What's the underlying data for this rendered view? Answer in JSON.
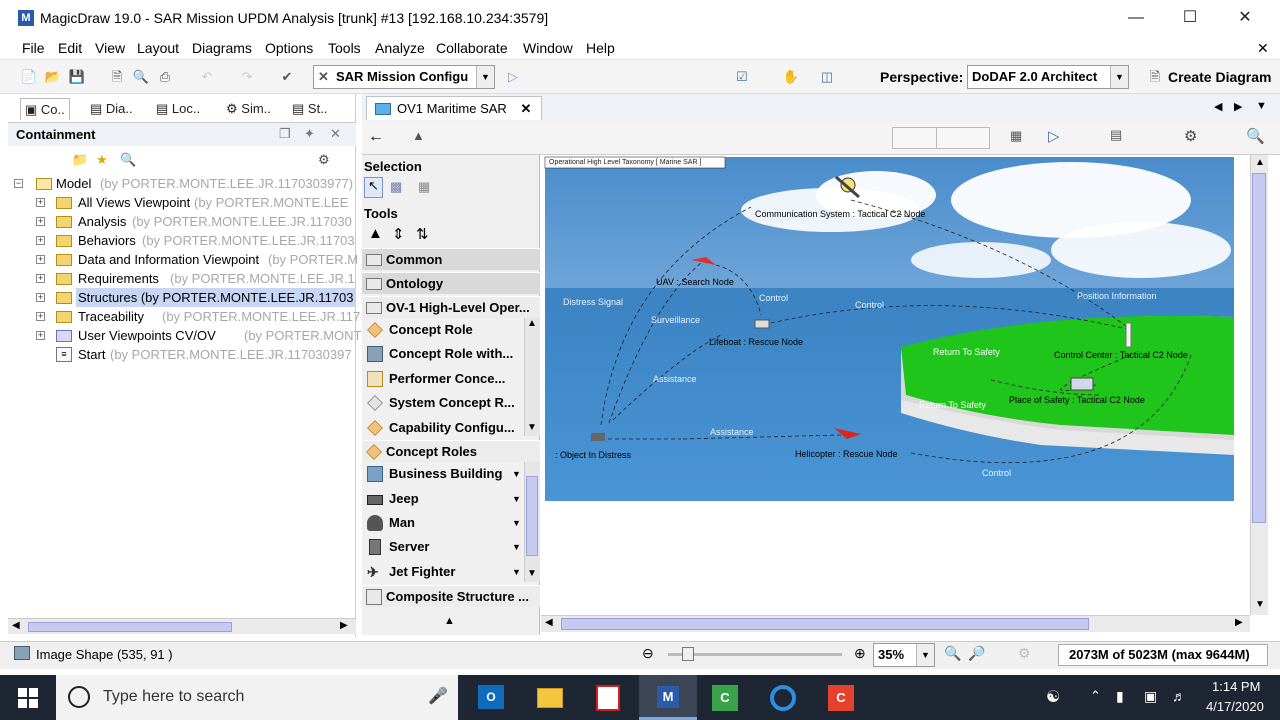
{
  "window": {
    "title": "MagicDraw 19.0 - SAR Mission UPDM Analysis [trunk] #13 [192.168.10.234:3579]"
  },
  "menu": [
    "File",
    "Edit",
    "View",
    "Layout",
    "Diagrams",
    "Options",
    "Tools",
    "Analyze",
    "Collaborate",
    "Window",
    "Help"
  ],
  "toolbar": {
    "config_value": "SAR Mission Configu",
    "perspective_label": "Perspective:",
    "perspective_value": "DoDAF 2.0 Architect",
    "create_diagram": "Create Diagram"
  },
  "left_tabs": [
    "Co..",
    "Dia..",
    "Loc..",
    "Sim..",
    "St.."
  ],
  "containment": {
    "title": "Containment",
    "tree": [
      {
        "name": "Model",
        "owner": "(by PORTER.MONTE.LEE.JR.1170303977)"
      },
      {
        "name": "All Views Viewpoint",
        "owner": "(by PORTER.MONTE.LEE"
      },
      {
        "name": "Analysis",
        "owner": "(by PORTER.MONTE.LEE.JR.117030"
      },
      {
        "name": "Behaviors",
        "owner": "(by PORTER.MONTE.LEE.JR.11703"
      },
      {
        "name": "Data and Information Viewpoint",
        "owner": "(by PORTER.M"
      },
      {
        "name": "Requirements",
        "owner": "(by PORTER.MONTE.LEE.JR.1"
      },
      {
        "name": "Structures (by PORTER.MONTE.LEE.JR.11703",
        "owner": ""
      },
      {
        "name": "Traceability",
        "owner": "(by PORTER.MONTE.LEE.JR.117"
      },
      {
        "name": "User Viewpoints CV/OV",
        "owner": "(by PORTER.MONTE.L"
      },
      {
        "name": "Start",
        "owner": "(by PORTER.MONTE.LEE.JR.117030397"
      }
    ]
  },
  "diagram_tab": "OV1 Maritime SAR",
  "palette": {
    "selection": "Selection",
    "tools": "Tools",
    "groups": [
      "Common",
      "Ontology",
      "OV-1 High-Level Oper...",
      "Concept Roles",
      "Composite Structure ..."
    ],
    "ov1_items": [
      "Concept Role",
      "Concept Role with...",
      "Performer Conce...",
      "System Concept R...",
      "Capability Configu..."
    ],
    "role_items": [
      "Business Building",
      "Jeep",
      "Man",
      "Server",
      "Jet Fighter"
    ]
  },
  "diagram": {
    "frame_label": "Operational High Level Taxonomy  [ Marine SAR ]",
    "nodes": [
      "Communication System : Tactical C2 Node",
      "UAV : Search Node",
      "Lifeboat : Rescue Node",
      "Control Center : Tactical C2 Node",
      "Place of Safety : Tactical C2 Node",
      ": Object In Distress",
      "Helicopter : Rescue Node"
    ],
    "flows": [
      "Distress Signal",
      "Surveillance",
      "Control",
      "Control",
      "Position Information",
      "Return To Safety",
      "Return To Safety",
      "Assistance",
      "Assistance",
      "Control"
    ]
  },
  "status": {
    "selection": "Image Shape (535, 91 )",
    "zoom": "35%",
    "memory": "2073M of 5023M  (max 9644M)"
  },
  "taskbar": {
    "search_placeholder": "Type here to search",
    "time": "1:14 PM",
    "date": "4/17/2020"
  },
  "colors": {
    "sky": "#5b9bd6",
    "sea": "#3a86c8",
    "land": "#22c61a",
    "taskbar": "#1e2633"
  }
}
